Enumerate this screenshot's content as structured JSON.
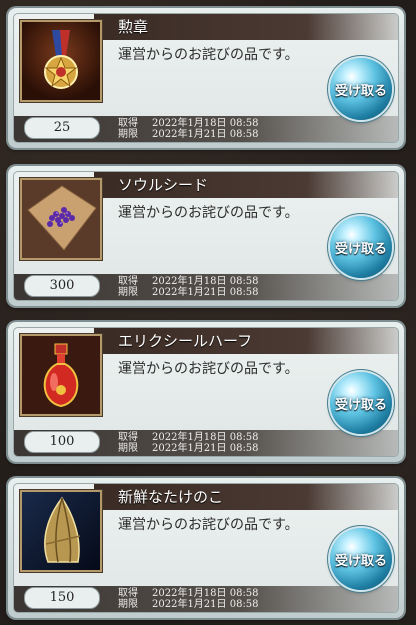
{
  "items": [
    {
      "name": "勲章",
      "description": "運営からのお詫びの品です。",
      "quantity": "25",
      "acquired_label": "取得",
      "acquired": "2022年1月18日 08:58",
      "expiry_label": "期限",
      "expiry": "2022年1月21日 08:58",
      "button_label": "受け取る",
      "icon": "medal-icon"
    },
    {
      "name": "ソウルシード",
      "description": "運営からのお詫びの品です。",
      "quantity": "300",
      "acquired_label": "取得",
      "acquired": "2022年1月18日 08:58",
      "expiry_label": "期限",
      "expiry": "2022年1月21日 08:58",
      "button_label": "受け取る",
      "icon": "soul-seed-icon"
    },
    {
      "name": "エリクシールハーフ",
      "description": "運営からのお詫びの品です。",
      "quantity": "100",
      "acquired_label": "取得",
      "acquired": "2022年1月18日 08:58",
      "expiry_label": "期限",
      "expiry": "2022年1月21日 08:58",
      "button_label": "受け取る",
      "icon": "potion-icon"
    },
    {
      "name": "新鮮なたけのこ",
      "description": "運営からのお詫びの品です。",
      "quantity": "150",
      "acquired_label": "取得",
      "acquired": "2022年1月18日 08:58",
      "expiry_label": "期限",
      "expiry": "2022年1月21日 08:58",
      "button_label": "受け取る",
      "icon": "bamboo-shoot-icon"
    }
  ]
}
